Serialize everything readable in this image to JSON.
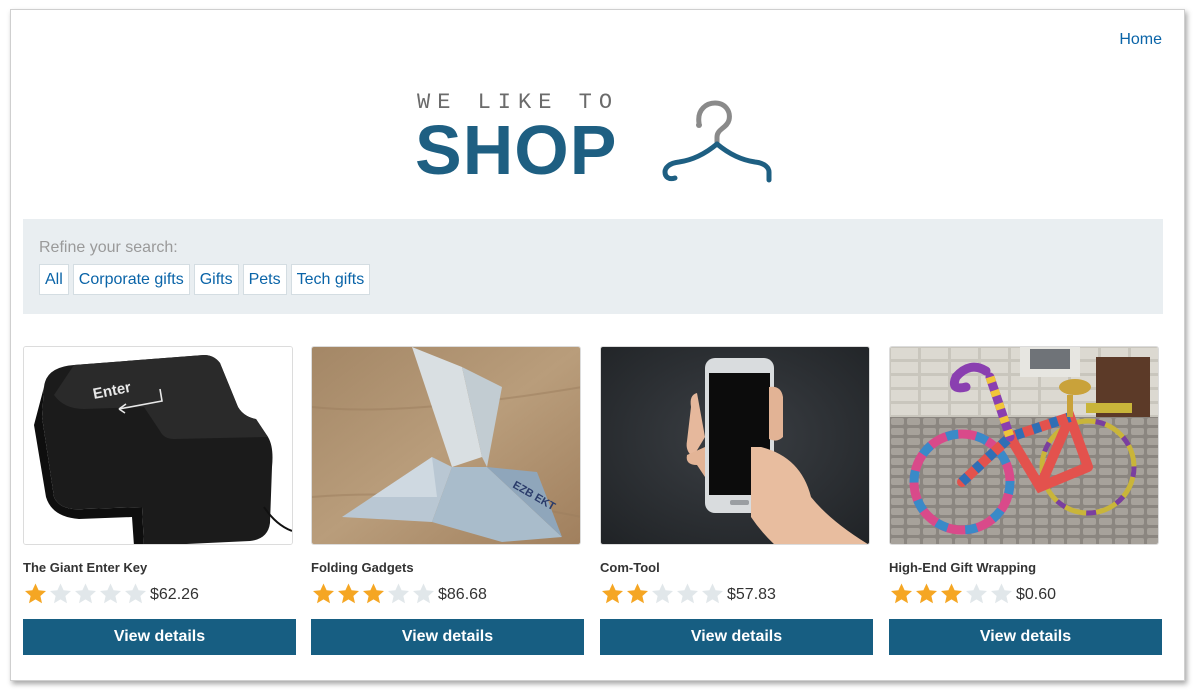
{
  "nav": {
    "home_label": "Home"
  },
  "logo": {
    "tagline": "WE LIKE TO",
    "wordmark": "SHOP",
    "icon": "hanger-icon",
    "color": "#1e5f82"
  },
  "refine": {
    "label": "Refine your search:",
    "filters": [
      "All",
      "Corporate gifts",
      "Gifts",
      "Pets",
      "Tech gifts"
    ]
  },
  "colors": {
    "accent": "#175e82",
    "link": "#0a64a8",
    "star_on": "#f5a623",
    "star_off": "#e1e7ea",
    "panel": "#e9eef1"
  },
  "products": [
    {
      "title": "The Giant Enter Key",
      "rating": 1,
      "max_rating": 5,
      "price": "$62.26",
      "button": "View details",
      "image": "giant-enter-key"
    },
    {
      "title": "Folding Gadgets",
      "rating": 3,
      "max_rating": 5,
      "price": "$86.68",
      "button": "View details",
      "image": "origami-bird"
    },
    {
      "title": "Com-Tool",
      "rating": 2,
      "max_rating": 5,
      "price": "$57.83",
      "button": "View details",
      "image": "hand-holding-phone"
    },
    {
      "title": "High-End Gift Wrapping",
      "rating": 3,
      "max_rating": 5,
      "price": "$0.60",
      "button": "View details",
      "image": "knitted-bicycle"
    }
  ]
}
